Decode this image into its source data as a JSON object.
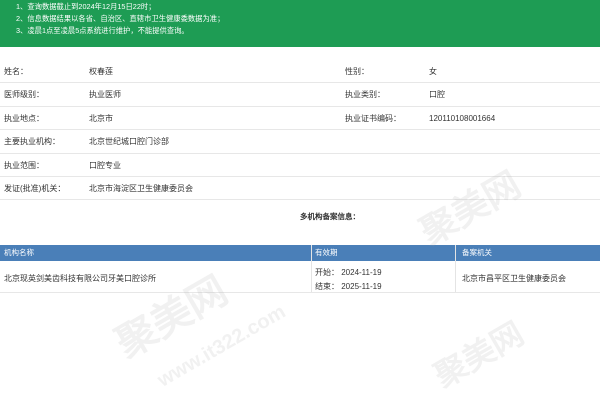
{
  "notice": {
    "lines": [
      "1、查询数据截止到2024年12月15日22时；",
      "2、信息数据结果以各省、自治区、直辖市卫生健康委数据为准；",
      "3、凌晨1点至凌晨5点系统进行维护，不能提供查询。"
    ]
  },
  "info": {
    "rows": [
      {
        "label1": "姓名：",
        "value1": "权春莲",
        "label2": "性别：",
        "value2": "女"
      },
      {
        "label1": "医师级别：",
        "value1": "执业医师",
        "label2": "执业类别：",
        "value2": "口腔"
      },
      {
        "label1": "执业地点：",
        "value1": "北京市",
        "label2": "执业证书编码：",
        "value2": "120110108001664"
      },
      {
        "label1": "主要执业机构：",
        "value1": "北京世纪城口腔门诊部"
      },
      {
        "label1": "执业范围：",
        "value1": "口腔专业"
      },
      {
        "label1": "发证(批准)机关：",
        "value1": "北京市海淀区卫生健康委员会"
      }
    ]
  },
  "multi_title": "多机构备案信息：",
  "institutions": {
    "headers": [
      "机构名称",
      "有效期",
      "备案机关"
    ],
    "rows": [
      {
        "name": "北京现英剑美齿科技有限公司牙美口腔诊所",
        "start": "开始： 2024-11-19",
        "end": "结束： 2025-11-19",
        "org": "北京市昌平区卫生健康委员会"
      }
    ]
  },
  "watermarks": [
    "聚美网",
    "聚美网",
    "www.it322.com",
    "聚美网"
  ],
  "colors": {
    "notice_bg": "#1e9c54",
    "table_header_bg": "#4a7fb8"
  }
}
